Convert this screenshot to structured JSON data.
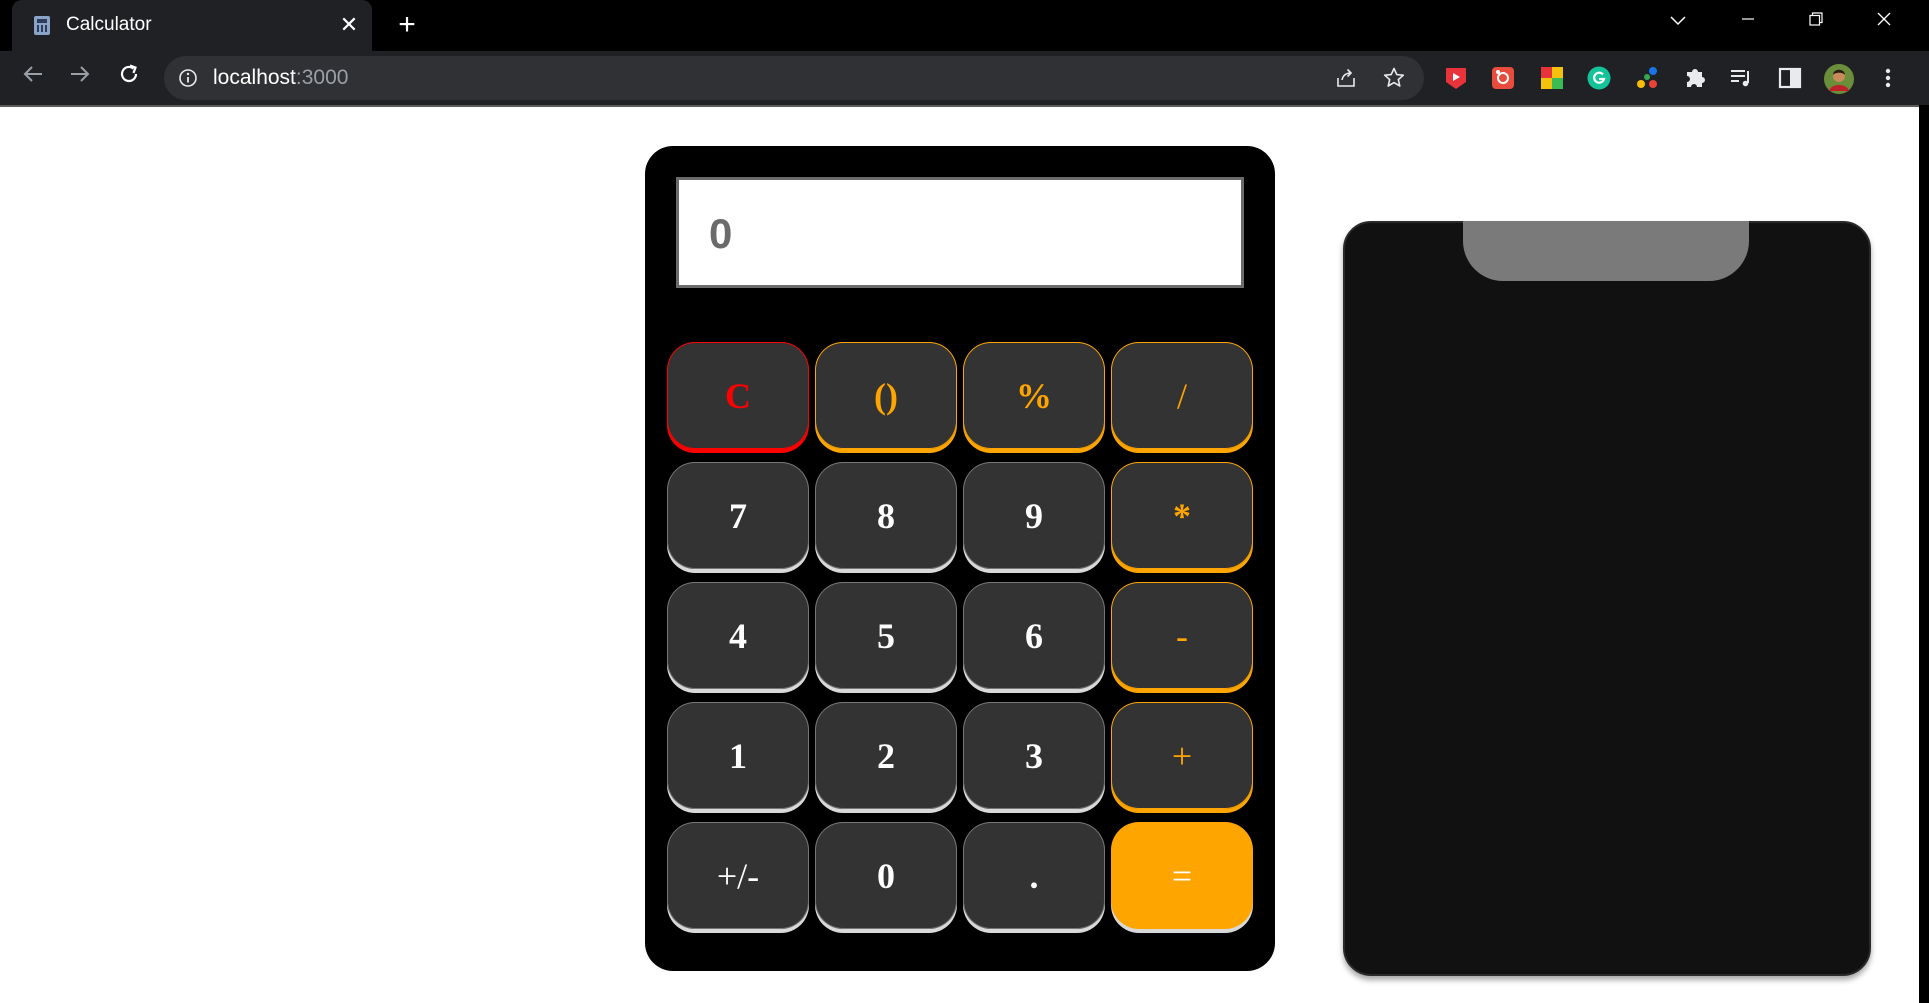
{
  "browser": {
    "tab_title": "Calculator",
    "tab_close": "✕",
    "new_tab": "+",
    "url_host": "localhost",
    "url_port": ":3000",
    "extensions": [
      "pdf-ext-icon",
      "screenshot-ext-icon",
      "color-ext-icon",
      "grammarly-icon",
      "dots-ext-icon",
      "puzzle-icon",
      "media-icon",
      "sidepanel-icon",
      "profile-avatar",
      "menu-icon"
    ]
  },
  "calculator": {
    "display": "0",
    "keys": [
      "C",
      "()",
      "%",
      "/",
      "7",
      "8",
      "9",
      "*",
      "4",
      "5",
      "6",
      "-",
      "1",
      "2",
      "3",
      "+",
      "+/-",
      "0",
      ".",
      "="
    ],
    "colors": {
      "accent": "#ffa500",
      "clear": "#ff0000",
      "key_bg": "#333333",
      "body": "#000000"
    }
  },
  "history": {}
}
